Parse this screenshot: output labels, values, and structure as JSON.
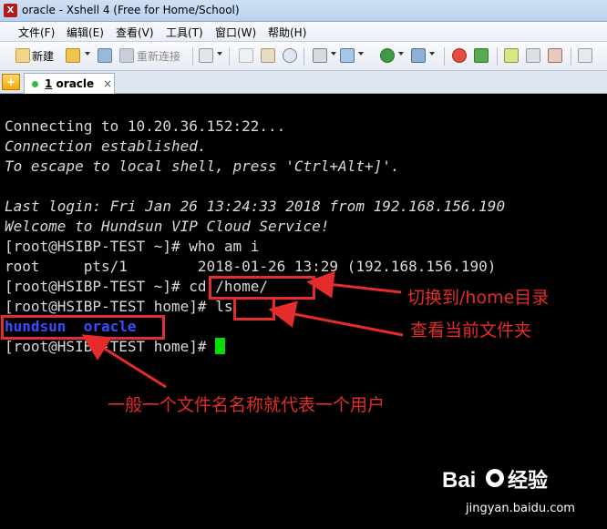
{
  "window": {
    "title": "oracle - Xshell 4 (Free for Home/School)"
  },
  "menu": [
    "文件(F)",
    "编辑(E)",
    "查看(V)",
    "工具(T)",
    "窗口(W)",
    "帮助(H)"
  ],
  "toolbar": {
    "new_label": "新建",
    "reconnect_label": "重新连接"
  },
  "tab": {
    "number": "1",
    "label": "oracle",
    "close": "×",
    "add": "+"
  },
  "terminal": {
    "lines": [
      "Connecting to 10.20.36.152:22...",
      "Connection established.",
      "To escape to local shell, press 'Ctrl+Alt+]'.",
      "",
      "Last login: Fri Jan 26 13:24:33 2018 from 192.168.156.190",
      "Welcome to Hundsun VIP Cloud Service!",
      "[root@HSIBP-TEST ~]# who am i",
      "root     pts/1        2018-01-26 13:29 (192.168.156.190)",
      "[root@HSIBP-TEST ~]# cd /home/",
      "[root@HSIBP-TEST home]# ls",
      "hundsun  oracle",
      "[root@HSIBP-TEST home]# "
    ],
    "prompt_cd": "[root@HSIBP-TEST ~]# ",
    "cmd_cd": "cd /home/",
    "prompt_ls": "[root@HSIBP-TEST home]# ",
    "cmd_ls": "ls",
    "dir1": "hundsun",
    "dir2": "oracle"
  },
  "annotations": {
    "switch": "切换到/home目录",
    "view": "查看当前文件夹",
    "user": "一般一个文件名名称就代表一个用户"
  },
  "watermark": {
    "site": "jingyan.baidu.com"
  },
  "colors": {
    "annotation": "#e52b2b",
    "cursor": "#00e000",
    "dir": "#3b4cff"
  }
}
